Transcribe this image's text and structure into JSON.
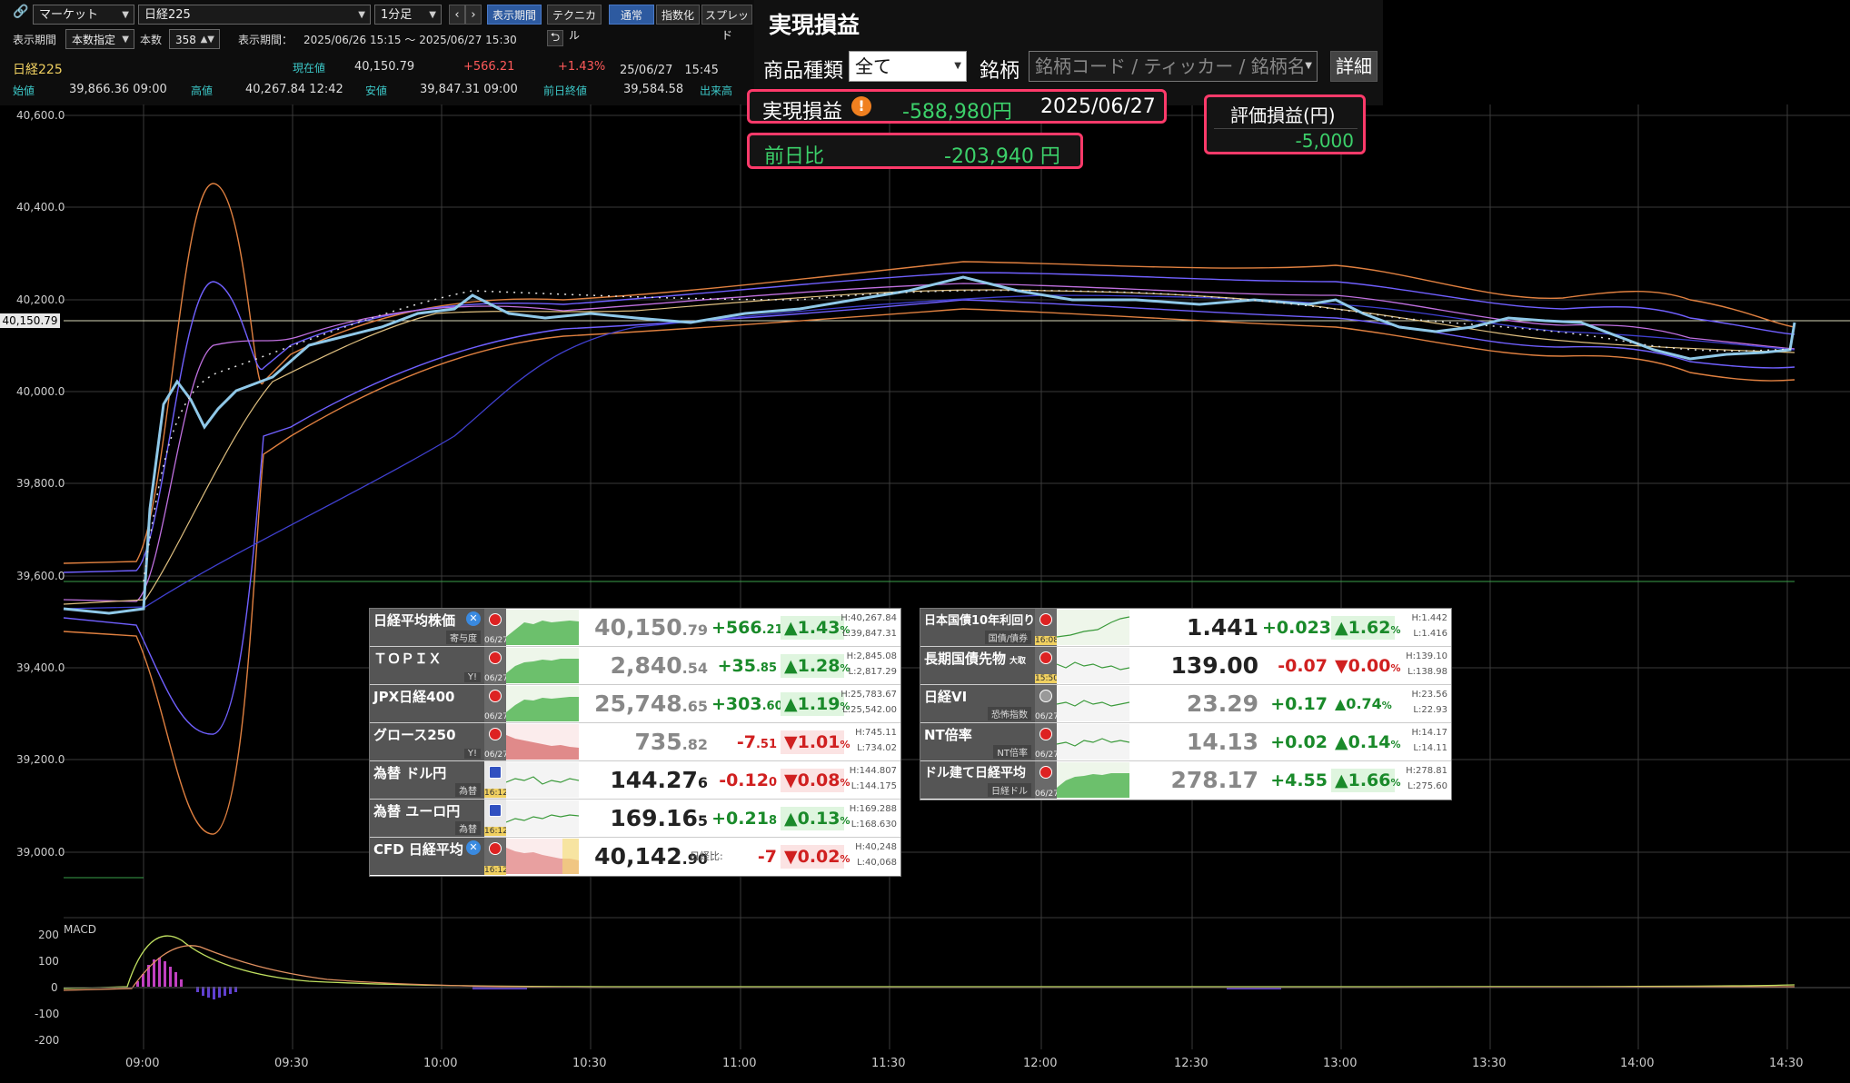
{
  "toolbar": {
    "link_icon": "link-icon",
    "market_select": "マーケット",
    "symbol_select": "日経225",
    "interval_select": "1分足",
    "btn_display_period": "表示期間",
    "btn_technical": "テクニカル",
    "btn_normal": "通常",
    "btn_index": "指数化",
    "btn_spread": "スプレッド",
    "period_label": "表示期間",
    "period_mode": "本数指定",
    "count_label": "本数",
    "count_value": "358",
    "range_label": "表示期間：",
    "range_value": "2025/06/26 15:15 ～ 2025/06/27 15:30"
  },
  "quote": {
    "symbol": "日経225",
    "current_label": "現在値",
    "current_value": "40,150.79",
    "change": "+566.21",
    "change_pct": "+1.43%",
    "time": "25/06/27　15:45",
    "open_label": "始値",
    "open_value": "39,866.36 09:00",
    "high_label": "高値",
    "high_value": "40,267.84 12:42",
    "low_label": "安値",
    "low_value": "39,847.31 09:00",
    "prev_label": "前日終値",
    "prev_value": "39,584.58",
    "volume_label": "出来高"
  },
  "pnl": {
    "title": "実現損益",
    "product_label": "商品種類",
    "product_value": "全て",
    "symbol_label": "銘柄",
    "symbol_placeholder": "銘柄コード / ティッカー / 銘柄名",
    "detail_button": "詳細",
    "realized_label": "実現損益",
    "realized_value": "-588,980円",
    "realized_date": "2025/06/27",
    "prev_day_label": "前日比",
    "prev_day_value": "-203,940 円",
    "valuation_label": "評価損益(円)",
    "valuation_value": "-5,000"
  },
  "chart": {
    "current_price_tag": "40,150.79",
    "y_labels": [
      "40,600.0",
      "40,400.0",
      "40,200.0",
      "40,000.0",
      "39,800.0",
      "39,600.0",
      "39,400.0",
      "39,200.0",
      "39,000.0"
    ],
    "macd_label": "MACD",
    "macd_labels": [
      "200",
      "100",
      "0",
      "-100",
      "-200"
    ],
    "x_labels": [
      "09:00",
      "09:30",
      "10:00",
      "10:30",
      "11:00",
      "11:30",
      "12:00",
      "12:30",
      "13:00",
      "13:30",
      "14:00",
      "14:30"
    ]
  },
  "left_table": [
    {
      "name": "日経平均株価",
      "sub": "寄与度",
      "date": "06/27",
      "price_main": "40,150",
      "price_dec": ".79",
      "chg_main": "+566",
      "chg_dec": ".21",
      "pct_main": "▲1.43",
      "pct_unit": "%",
      "high": "H:40,267.84",
      "low": "L:39,847.31",
      "dir": "pos"
    },
    {
      "name": "ＴＯＰＩＸ",
      "sub": "Y!",
      "date": "06/27",
      "price_main": "2,840",
      "price_dec": ".54",
      "chg_main": "+35",
      "chg_dec": ".85",
      "pct_main": "▲1.28",
      "pct_unit": "%",
      "high": "H:2,845.08",
      "low": "L:2,817.29",
      "dir": "pos"
    },
    {
      "name": "JPX日経400",
      "sub": "",
      "date": "06/27",
      "price_main": "25,748",
      "price_dec": ".65",
      "chg_main": "+303",
      "chg_dec": ".60",
      "pct_main": "▲1.19",
      "pct_unit": "%",
      "high": "H:25,783.67",
      "low": "L:25,542.00",
      "dir": "pos"
    },
    {
      "name": "グロース250",
      "sub": "Y!",
      "date": "06/27",
      "price_main": "735",
      "price_dec": ".82",
      "chg_main": "-7",
      "chg_dec": ".51",
      "pct_main": "▼1.01",
      "pct_unit": "%",
      "high": "H:745.11",
      "low": "L:734.02",
      "dir": "neg"
    },
    {
      "name": "為替 ドル円",
      "sub": "為替",
      "date": "16:12",
      "price_main": "144.27",
      "price_dec": "6",
      "chg_main": "-0.12",
      "chg_dec": "0",
      "pct_main": "▼0.08",
      "pct_unit": "%",
      "high": "H:144.807",
      "low": "L:144.175",
      "dir": "neg"
    },
    {
      "name": "為替 ユーロ円",
      "sub": "為替",
      "date": "16:12",
      "price_main": "169.16",
      "price_dec": "5",
      "chg_main": "+0.21",
      "chg_dec": "8",
      "pct_main": "▲0.13",
      "pct_unit": "%",
      "high": "H:169.288",
      "low": "L:168.630",
      "dir": "pos"
    },
    {
      "name": "CFD 日経平均",
      "sub": "",
      "date": "16:12",
      "price_main": "40,142",
      "price_dec": ".90",
      "chg_label": "日経比:",
      "chg_main": "-7",
      "chg_dec": "",
      "pct_main": "▼0.02",
      "pct_unit": "%",
      "high": "H:40,248",
      "low": "L:40,068",
      "dir": "neg"
    }
  ],
  "right_table": [
    {
      "name": "日本国債10年利回り",
      "sub": "国債/債券",
      "date": "16:08",
      "price_main": "1.441",
      "price_dec": "",
      "chg_main": "+0.023",
      "chg_dec": "",
      "pct_main": "▲1.62",
      "pct_unit": "%",
      "high": "H:1.442",
      "low": "L:1.416",
      "dir": "pos"
    },
    {
      "name": "長期国債先物",
      "tag": "大取",
      "sub": "",
      "date": "15:50",
      "price_main": "139.00",
      "price_dec": "",
      "chg_main": "-0.07",
      "chg_dec": "",
      "pct_main": "▼0.00",
      "pct_unit": "%",
      "high": "H:139.10",
      "low": "L:138.98",
      "dir": "neg"
    },
    {
      "name": "日経VI",
      "sub": "恐怖指数",
      "date": "06/27",
      "price_main": "23.29",
      "price_dec": "",
      "chg_main": "+0.17",
      "chg_dec": "",
      "pct_main": "▲0.74",
      "pct_unit": "%",
      "high": "H:23.56",
      "low": "L:22.93",
      "dir": "pos"
    },
    {
      "name": "NT倍率",
      "sub": "NT倍率",
      "date": "06/27",
      "price_main": "14.13",
      "price_dec": "",
      "chg_main": "+0.02",
      "chg_dec": "",
      "pct_main": "▲0.14",
      "pct_unit": "%",
      "high": "H:14.17",
      "low": "L:14.11",
      "dir": "pos"
    },
    {
      "name": "ドル建て日経平均",
      "sub": "日経ドル",
      "date": "06/27",
      "price_main": "278.17",
      "price_dec": "",
      "chg_main": "+4.55",
      "chg_dec": "",
      "pct_main": "▲1.66",
      "pct_unit": "%",
      "high": "H:278.81",
      "low": "L:275.60",
      "dir": "pos"
    }
  ]
}
